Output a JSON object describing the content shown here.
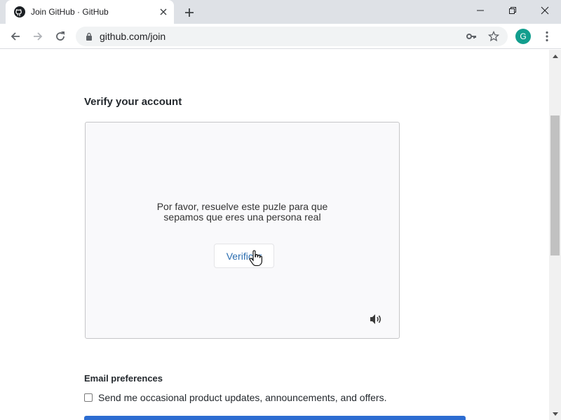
{
  "browser": {
    "tab_title": "Join GitHub · GitHub",
    "url": "github.com/join",
    "profile_initial": "G",
    "icons": {
      "favicon": "github-logo-icon",
      "close_tab": "close-icon",
      "new_tab": "plus-icon",
      "minimize": "minimize-icon",
      "maximize": "restore-icon",
      "close_window": "close-icon",
      "back": "arrow-left-icon",
      "forward": "arrow-right-icon",
      "reload": "reload-icon",
      "lock": "lock-icon",
      "key": "key-icon",
      "bookmark": "star-icon",
      "menu": "kebab-menu-icon"
    }
  },
  "page": {
    "section_title": "Verify your account",
    "captcha": {
      "message_line1": "Por favor, resuelve este puzle para que",
      "message_line2": "sepamos que eres una persona real",
      "verify_label": "Verificar",
      "audio_icon": "speaker-icon"
    },
    "email_preferences": {
      "heading": "Email preferences",
      "checkbox_label": "Send me occasional product updates, announcements, and offers.",
      "checked": false
    }
  },
  "colors": {
    "accent_link": "#2a6db0",
    "primary_button": "#2c6cd1",
    "avatar_bg": "#129e8e"
  }
}
